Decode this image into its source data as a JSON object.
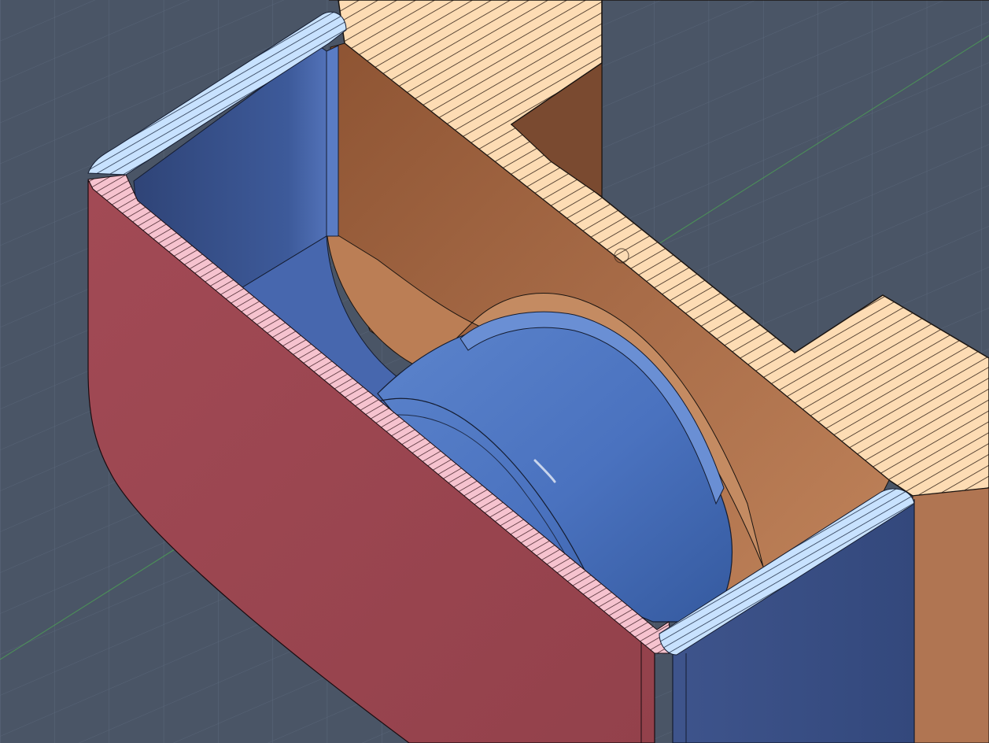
{
  "viewport": {
    "background": "#4a5566",
    "grid_color": "#6b7a8f",
    "axis_x_color": "#c0504d",
    "axis_y_color": "#4caf50"
  },
  "parts": [
    {
      "name": "outer-shell-front-wall",
      "color": "#98434d"
    },
    {
      "name": "inner-cup-blue",
      "color": "#3d5a9a"
    },
    {
      "name": "roller-cylinder",
      "color": "#4a72bf"
    },
    {
      "name": "copper-housing",
      "color": "#a56a48"
    },
    {
      "name": "section-cut-face-orange",
      "color": "#fddcb4"
    },
    {
      "name": "section-cut-face-blue",
      "color": "#c8e2ff"
    },
    {
      "name": "section-cut-face-pink",
      "color": "#f6c3cf"
    }
  ]
}
